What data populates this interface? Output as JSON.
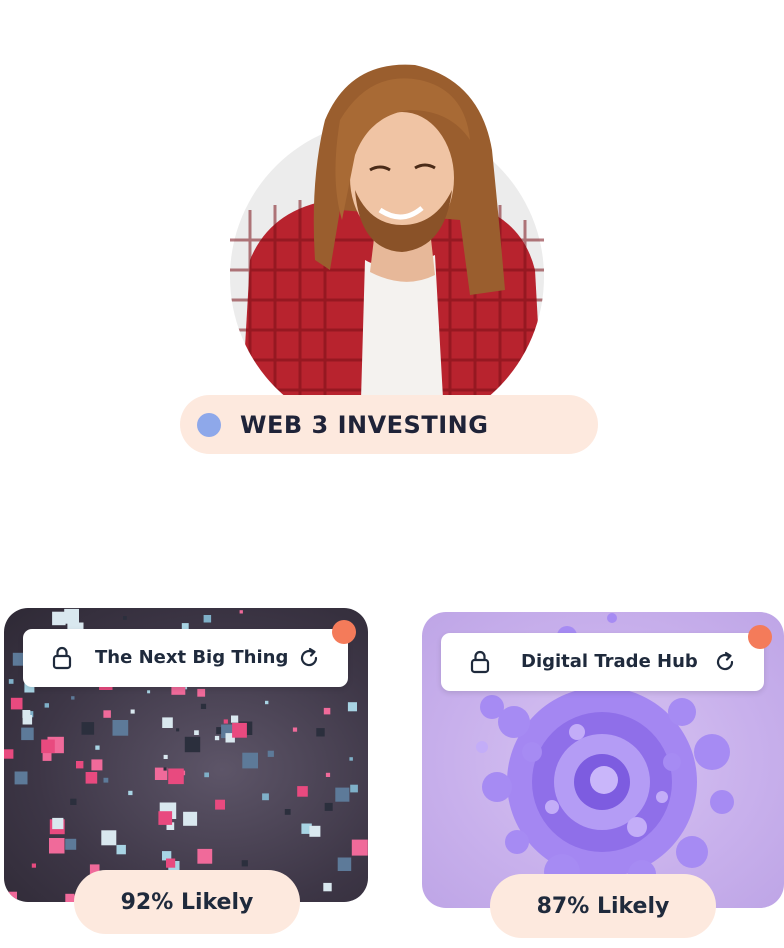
{
  "hero": {
    "tag_label": "WEB 3 INVESTING",
    "tag_dot_color": "#8ea8ea",
    "avatar_icon": "person-avatar"
  },
  "cards": [
    {
      "title": "The Next Big Thing",
      "likelihood": "92% Likely",
      "lock_icon": "lock-icon",
      "refresh_icon": "refresh-icon",
      "artwork": "floating-cubes"
    },
    {
      "title": "Digital Trade Hub",
      "likelihood": "87% Likely",
      "lock_icon": "lock-icon",
      "refresh_icon": "refresh-icon",
      "artwork": "purple-swirl"
    }
  ],
  "colors": {
    "accent_notification": "#f47b5a",
    "pill_background": "#fde9de",
    "text_dark": "#1f2a3c"
  }
}
